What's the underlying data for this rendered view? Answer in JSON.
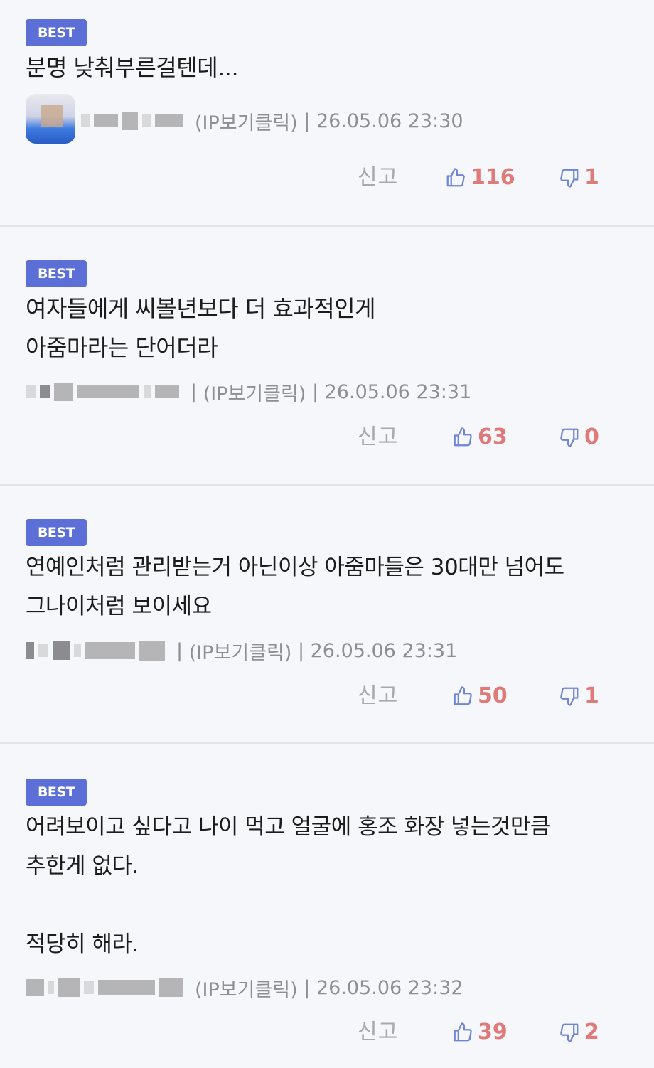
{
  "comments": [
    {
      "badge": "BEST",
      "text": "분명 낮춰부른걸텐데...",
      "ip": "(IP보기클릭)",
      "date": "26.05.06 23:30",
      "report": "신고",
      "likes": "116",
      "dislikes": "1"
    },
    {
      "badge": "BEST",
      "text": "여자들에게 씨볼년보다 더 효과적인게\n아줌마라는 단어더라",
      "ip": "(IP보기클릭)",
      "date": "26.05.06 23:31",
      "report": "신고",
      "likes": "63",
      "dislikes": "0"
    },
    {
      "badge": "BEST",
      "text": "연예인처럼 관리받는거 아닌이상 아줌마들은 30대만 넘어도\n그나이처럼 보이세요",
      "ip": "(IP보기클릭)",
      "date": "26.05.06 23:31",
      "report": "신고",
      "likes": "50",
      "dislikes": "1"
    },
    {
      "badge": "BEST",
      "text": "어려보이고 싶다고 나이 먹고 얼굴에 홍조 화장 넣는것만큼\n추한게 없다.\n\n적당히 해라.",
      "ip": "(IP보기클릭)",
      "date": "26.05.06 23:32",
      "report": "신고",
      "likes": "39",
      "dislikes": "2"
    }
  ],
  "colors": {
    "badge": "#5b6fd6",
    "vote_count": "#e07a78",
    "thumb_icon": "#6f86d8",
    "divider": "#e3e4ea"
  },
  "icons": [
    "thumbs-up-icon",
    "thumbs-down-icon"
  ]
}
